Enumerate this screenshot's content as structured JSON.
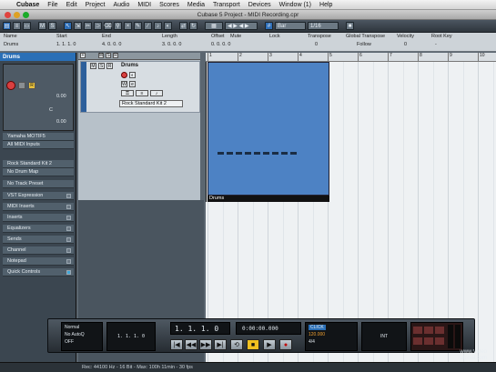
{
  "menubar": {
    "items": [
      "Cubase",
      "File",
      "Edit",
      "Project",
      "Audio",
      "MIDI",
      "Scores",
      "Media",
      "Transport",
      "Devices",
      "Window (1)",
      "Help"
    ]
  },
  "window": {
    "title": "Cubase 5 Project - MIDI Recording.cpr"
  },
  "toolbar": {
    "snap_type": "Bar",
    "quantize": "1/16"
  },
  "infoline": {
    "headers": [
      "Name",
      "Start",
      "End",
      "Length",
      "Offset",
      "Mute",
      "Lock",
      "Transpose",
      "Global Transpose",
      "Velocity",
      "Root Key"
    ],
    "values": [
      "Drums",
      "1. 1. 1. 0",
      "4. 0. 0. 0",
      "3. 0. 0. 0",
      "0. 0. 0. 0",
      "",
      "",
      "0",
      "Follow",
      "0",
      "-"
    ]
  },
  "inspector": {
    "title": "Drums",
    "volume": "0.00",
    "pan": "C",
    "delay": "0.00",
    "output": "Yamaha MOTIF5",
    "input": "All MIDI Inputs",
    "instrument": "Rock Standard Kit 2",
    "drum_map": "No Drum Map",
    "track_preset": "No Track Preset",
    "sections": [
      "VST Expression",
      "MIDI Inserts",
      "Inserts",
      "Equalizers",
      "Sends",
      "Channel",
      "Notepad",
      "Quick Controls"
    ]
  },
  "track": {
    "name": "Drums",
    "preset": "Rock Standard Kit 2"
  },
  "ruler": {
    "marks": [
      "1",
      "2",
      "3",
      "4",
      "5",
      "6",
      "7",
      "8",
      "9",
      "10"
    ]
  },
  "part": {
    "name": "Drums"
  },
  "transport": {
    "mode": "Normal",
    "auto_quant": "No AutoQ",
    "metronome": "OFF",
    "position_primary": "1. 1. 1. 0",
    "position_secondary": "0:00:00.000",
    "tempo": "120.000",
    "signature": "4/4",
    "sync": "INT",
    "click": "CLICK",
    "buttons": [
      "|◀",
      "◀◀",
      "▶▶",
      "▶|",
      "⟲",
      "■",
      "▶",
      "●"
    ]
  },
  "statusbar": {
    "text": "Rec: 44100 Hz - 16 Bit - Max: 100h 11min - 30 fps"
  },
  "watermark": {
    "line1": "www.Video",
    "line2": "Tutorial.com"
  },
  "colors": {
    "part_blue": "#4d82c4",
    "accent_blue": "#2a6fb6",
    "record_red": "#d94040"
  }
}
